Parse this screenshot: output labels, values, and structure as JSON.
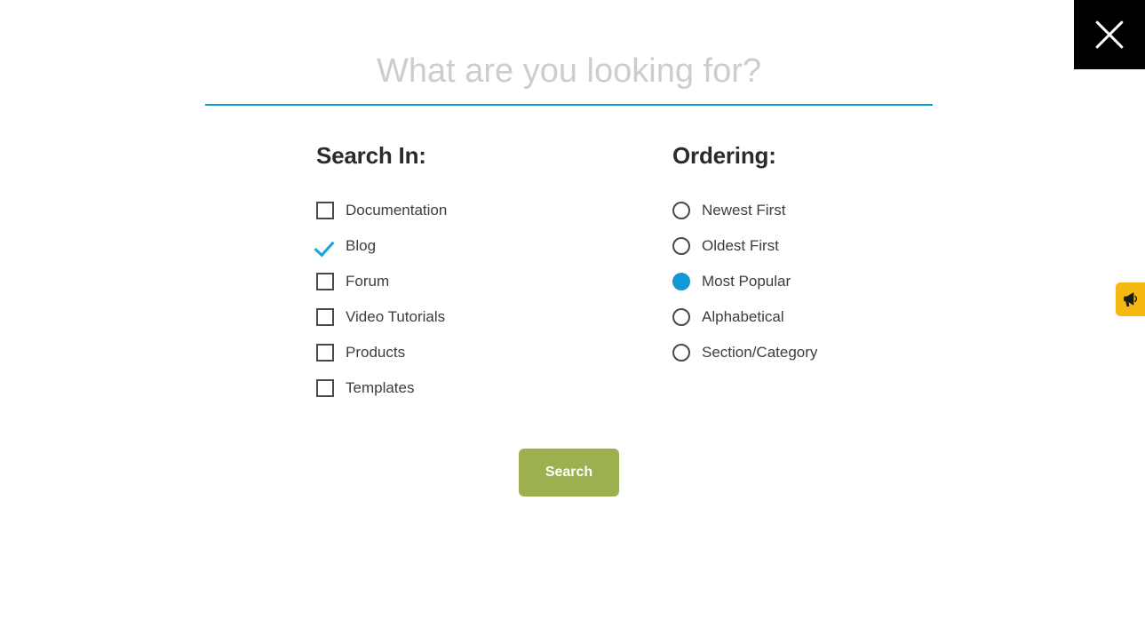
{
  "overlay": {
    "close_button_label": "Close search",
    "close_icon": "close-x-icon"
  },
  "search": {
    "placeholder": "What are you looking for?",
    "value": "",
    "underline_color": "#0a9ad6"
  },
  "search_in": {
    "title": "Search In:",
    "options": [
      {
        "label": "Documentation",
        "checked": false
      },
      {
        "label": "Blog",
        "checked": true
      },
      {
        "label": "Forum",
        "checked": false
      },
      {
        "label": "Video Tutorials",
        "checked": false
      },
      {
        "label": "Products",
        "checked": false
      },
      {
        "label": "Templates",
        "checked": false
      }
    ]
  },
  "ordering": {
    "title": "Ordering:",
    "options": [
      {
        "label": "Newest First",
        "selected": false
      },
      {
        "label": "Oldest First",
        "selected": false
      },
      {
        "label": "Most Popular",
        "selected": true
      },
      {
        "label": "Alphabetical",
        "selected": false
      },
      {
        "label": "Section/Category",
        "selected": false
      }
    ]
  },
  "submit": {
    "label": "Search",
    "color": "#9cb04f"
  },
  "feedback_tab": {
    "icon": "megaphone-icon",
    "color": "#f5b912"
  },
  "colors": {
    "accent_blue": "#17a4dd",
    "checkbox_border": "#46494b",
    "heading": "#2b2b2b",
    "label_text": "#3d3d3d",
    "placeholder": "#cdcdcd"
  }
}
